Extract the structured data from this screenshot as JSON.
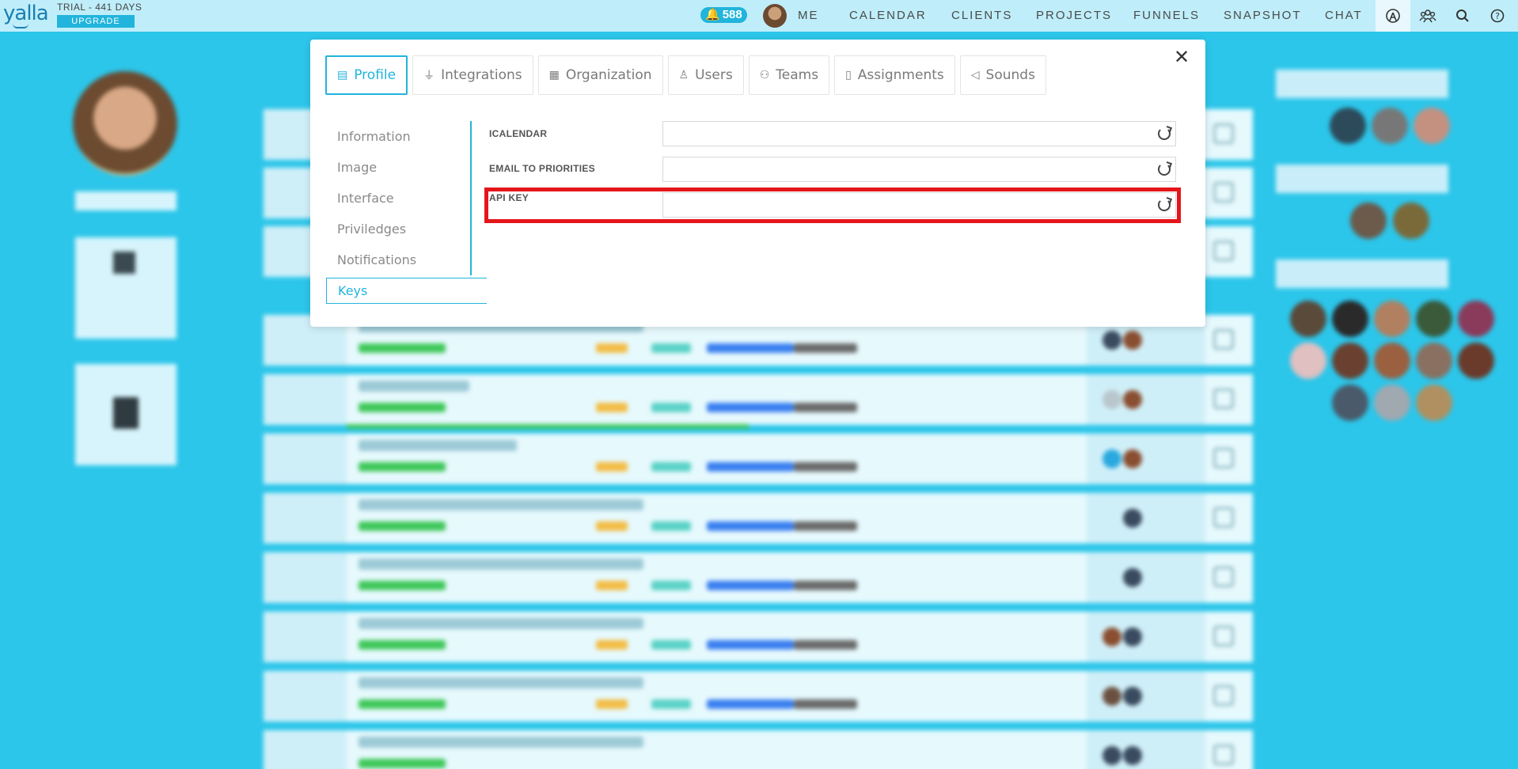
{
  "topbar": {
    "logo": "yalla",
    "trial_label": "TRIAL - 441 DAYS",
    "upgrade_label": "UPGRADE",
    "notification_count": "588",
    "nav": [
      "ME",
      "CALENDAR",
      "CLIENTS",
      "PROJECTS",
      "FUNNELS",
      "SNAPSHOT",
      "CHAT"
    ],
    "icons": [
      "broadcast-icon",
      "team-icon",
      "search-icon",
      "help-icon"
    ]
  },
  "modal": {
    "tabs": [
      {
        "label": "Profile",
        "icon": "profile-card-icon",
        "active": true
      },
      {
        "label": "Integrations",
        "icon": "plug-icon"
      },
      {
        "label": "Organization",
        "icon": "building-icon"
      },
      {
        "label": "Users",
        "icon": "user-icon"
      },
      {
        "label": "Teams",
        "icon": "teams-icon"
      },
      {
        "label": "Assignments",
        "icon": "notebook-icon"
      },
      {
        "label": "Sounds",
        "icon": "speaker-icon"
      }
    ],
    "submenu": [
      "Information",
      "Image",
      "Interface",
      "Priviledges",
      "Notifications",
      "Keys"
    ],
    "active_submenu": "Keys",
    "fields": [
      {
        "label": "ICALENDAR",
        "value": ""
      },
      {
        "label": "EMAIL TO PRIORITIES",
        "value": ""
      },
      {
        "label": "API KEY",
        "value": ""
      }
    ],
    "highlight_color": "#e4161b",
    "accent_color": "#21b4dc"
  }
}
